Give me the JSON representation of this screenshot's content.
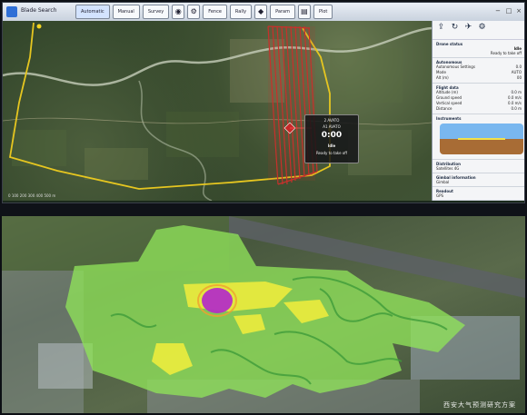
{
  "app": {
    "title": "Blade Search"
  },
  "toolbar": {
    "tabs": [
      "Automatic",
      "Manual",
      "Survey",
      "Fence",
      "Rally",
      "Param",
      "Plot"
    ],
    "active_tab": "Automatic",
    "icons": [
      "camera-icon",
      "gear-icon",
      "waypoint-icon",
      "chart-icon"
    ]
  },
  "window": {
    "controls": [
      "−",
      "□",
      "×"
    ]
  },
  "map": {
    "scale_label": "0 100 200 300 400 500 m",
    "overlay": {
      "line1": "2 AVATO",
      "line2": "A1 AVATO",
      "time": "0:00",
      "status": "Idle",
      "sub": "Ready to take off"
    }
  },
  "panel": {
    "icons": [
      "upload-icon",
      "sync-icon",
      "arm-icon",
      "settings-icon"
    ],
    "drone_status": {
      "title": "Drone status",
      "state": "Idle",
      "sub": "Ready to take off"
    },
    "autonomous": {
      "title": "Autonomous",
      "rows": [
        {
          "k": "Autonomous Settings",
          "v": "0.0"
        },
        {
          "k": "Mode",
          "v": "AUTO"
        },
        {
          "k": "Alt (m)",
          "v": "00"
        }
      ]
    },
    "flight_data": {
      "title": "Flight data",
      "rows": [
        {
          "k": "Altitude (m)",
          "v": "0.0 m"
        },
        {
          "k": "Ground speed",
          "v": "0.0 m/s"
        },
        {
          "k": "Vertical speed",
          "v": "0.0 m/s"
        },
        {
          "k": "Distance",
          "v": "0.0 m"
        }
      ]
    },
    "instruments": {
      "title": "Instruments"
    },
    "distribution": {
      "title": "Distribution",
      "row": "Satellites 4G"
    },
    "gimbal": {
      "title": "Gimbal information",
      "row": "Gimbal"
    },
    "readout": {
      "title": "Readout",
      "row": "GPS"
    }
  },
  "bottom": {
    "watermark": "西安大气预测研究方案"
  },
  "colors": {
    "flight_zone": "#c9302c",
    "boundary": "#e6c620",
    "river": "#cfd6c3",
    "heat_low": "#8fe35a",
    "heat_mid": "#f3ee3c",
    "heat_high": "#b42fc4"
  }
}
